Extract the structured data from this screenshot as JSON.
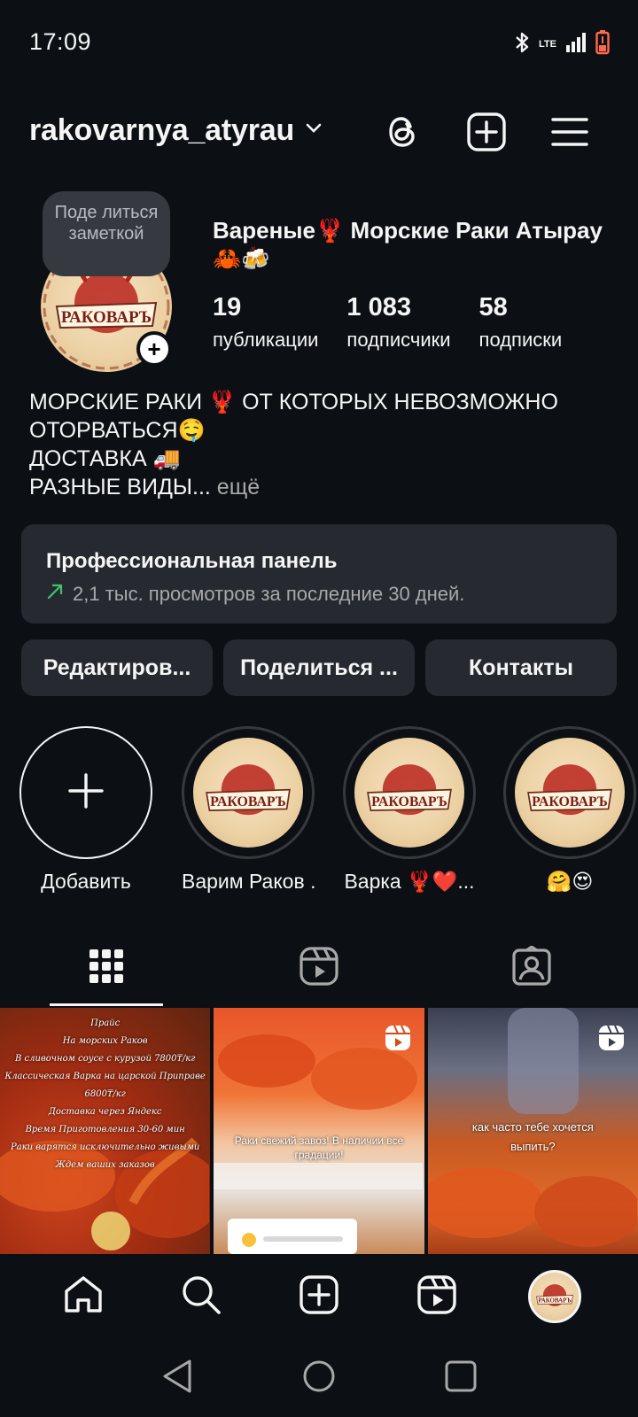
{
  "status_bar": {
    "time": "17:09",
    "network": "LTE"
  },
  "header": {
    "username": "rakovarnya_atyrau"
  },
  "profile": {
    "note": "Поде литься заметкой",
    "name": "Вареные🦞 Морские Раки Атырау 🦀🍻",
    "logo_text": "РАКОВАРЪ",
    "stats": [
      {
        "value": "19",
        "label": "публикации"
      },
      {
        "value": "1 083",
        "label": "подписчики"
      },
      {
        "value": "58",
        "label": "подписки"
      }
    ],
    "bio_lines": [
      "МОРСКИЕ РАКИ 🦞 ОТ КОТОРЫХ НЕВОЗМОЖНО ОТОРВАТЬСЯ🤤",
      "ДОСТАВКА 🚚",
      "РАЗНЫЕ ВИДЫ..."
    ],
    "bio_more": " ещё"
  },
  "pro_panel": {
    "title": "Профессиональная панель",
    "subtitle": "2,1 тыс. просмотров за последние 30 дней."
  },
  "actions": [
    {
      "label": "Редактиров..."
    },
    {
      "label": "Поделиться ..."
    },
    {
      "label": "Контакты"
    }
  ],
  "highlights": [
    {
      "label": "Добавить"
    },
    {
      "label": "Варим Раков ..."
    },
    {
      "label": "Варка 🦞❤️..."
    },
    {
      "label": "🤗😍"
    }
  ],
  "grid": {
    "post1_lines": [
      "Прайс",
      "На морских Раков",
      "В сливочном соусе с курузой 7800₸/кг",
      "Классическая Варка на царской Приправе 6800₸/кг",
      "Доставка через Яндекс",
      "Время Приготовления 30-60 мин",
      "Раки варятся исключительно живыми",
      "Ждем ваших заказов"
    ],
    "post2_caption": "Раки свежий завоз! В наличии все градации!",
    "post3_caption": "как часто тебе хочется выпить?"
  }
}
